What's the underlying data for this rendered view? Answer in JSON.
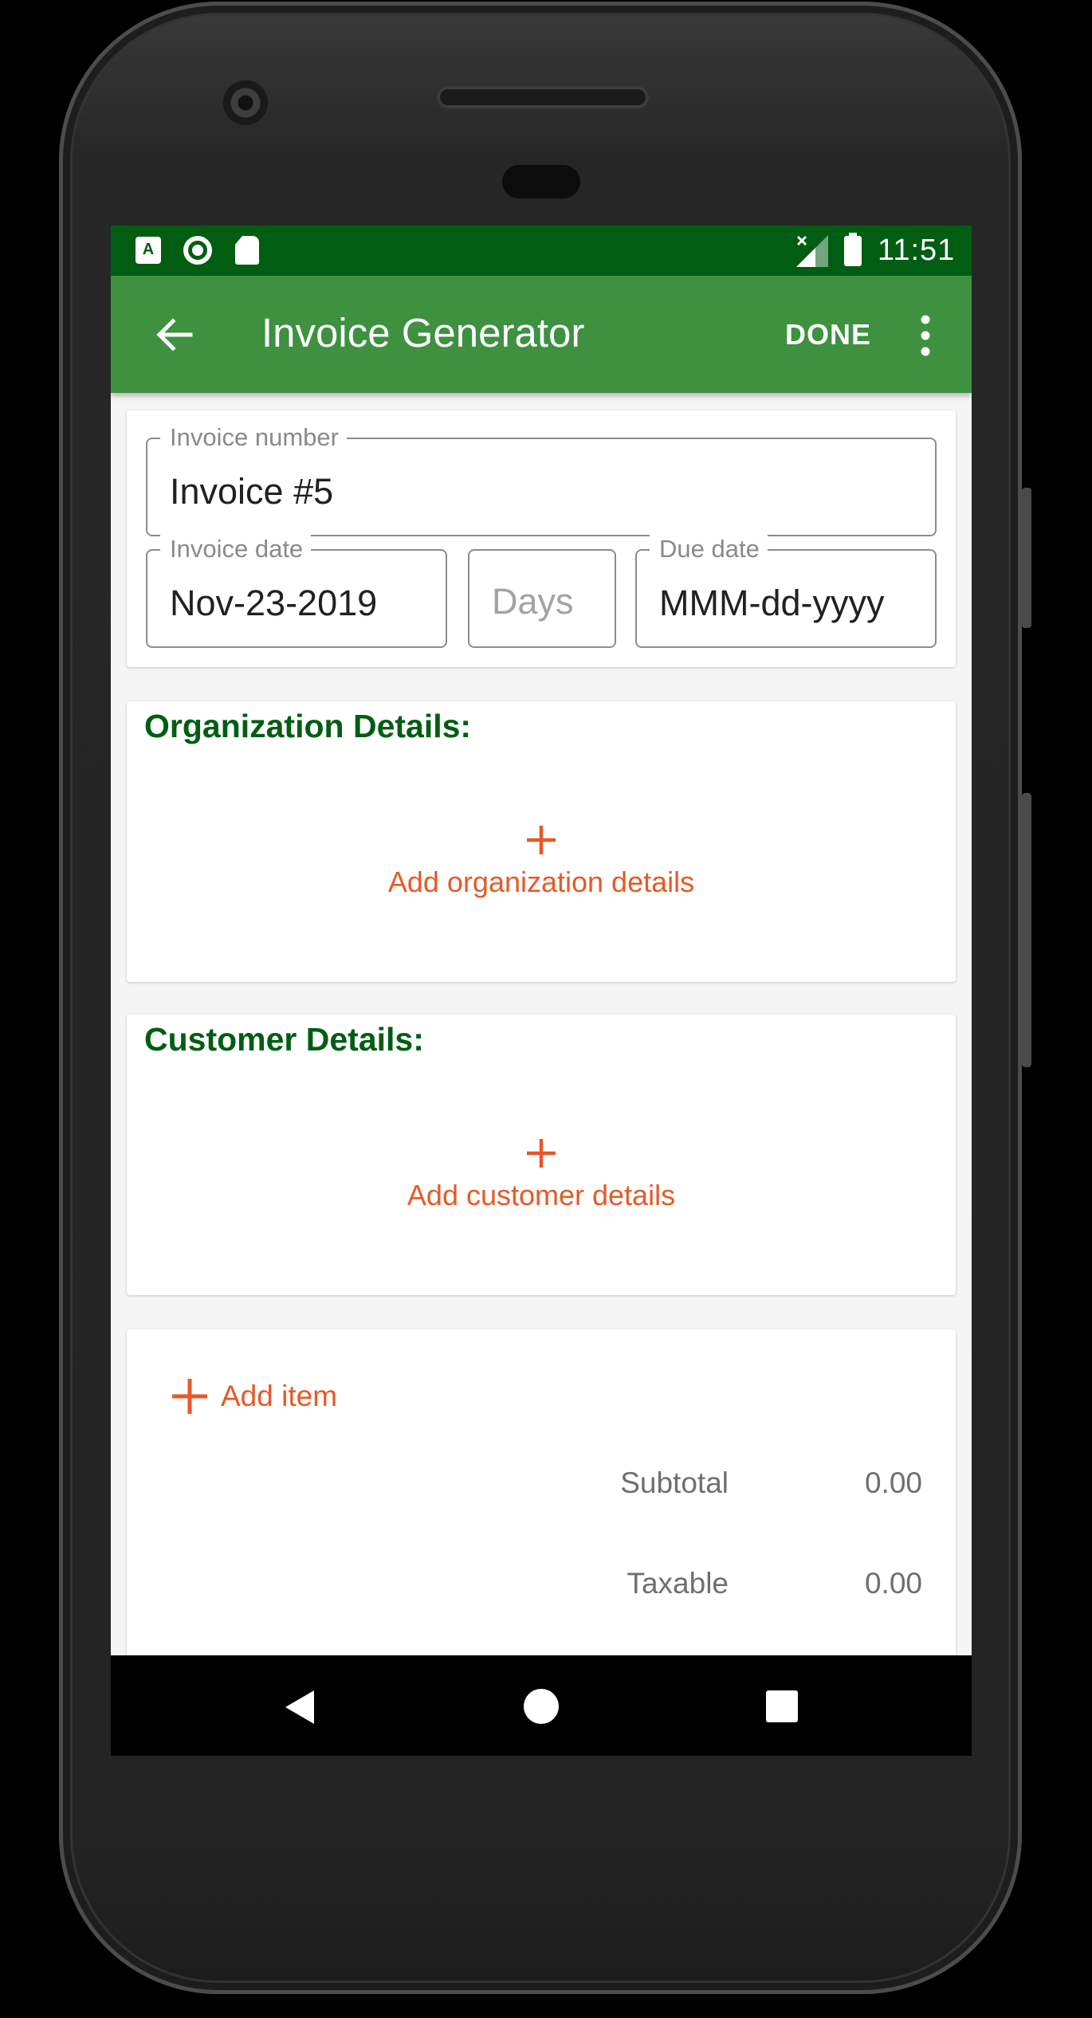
{
  "status_bar": {
    "notification_icons": [
      "accessibility-a-icon",
      "circle-sync-icon",
      "sd-card-icon"
    ],
    "time": "11:51",
    "a_badge": "A"
  },
  "app_bar": {
    "title": "Invoice Generator",
    "done_label": "DONE"
  },
  "invoice": {
    "number_label": "Invoice number",
    "number_value": "Invoice #5",
    "date_label": "Invoice date",
    "date_value": "Nov-23-2019",
    "days_placeholder": "Days",
    "due_label": "Due date",
    "due_value": "MMM-dd-yyyy"
  },
  "organization": {
    "title": "Organization Details:",
    "add_label": "Add organization details"
  },
  "customer": {
    "title": "Customer Details:",
    "add_label": "Add customer details"
  },
  "items": {
    "add_label": "Add item",
    "totals": [
      {
        "label": "Subtotal",
        "value": "0.00"
      },
      {
        "label": "Taxable",
        "value": "0.00"
      }
    ]
  },
  "colors": {
    "status_bar": "#005d12",
    "app_bar": "#3d913f",
    "section_title": "#005d12",
    "accent": "#e65a25"
  }
}
